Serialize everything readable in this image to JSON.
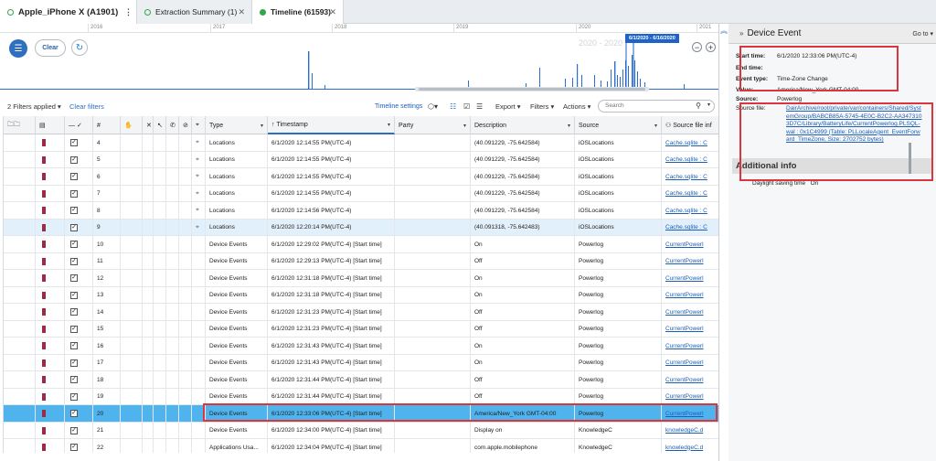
{
  "tabs": {
    "device": "Apple_iPhone X (A1901)",
    "extraction": "Extraction Summary (1)",
    "timeline": "Timeline (61593)"
  },
  "timeline": {
    "years": [
      "2016",
      "2017",
      "2018",
      "2019",
      "2020",
      "2021"
    ],
    "clear_label": "Clear",
    "range_label": "2020 - 2020",
    "range_badge": "6/1/2020 - 6/16/2020"
  },
  "filters": {
    "applied": "2 Filters applied ▾",
    "clear": "Clear filters",
    "timeline_settings": "Timeline settings",
    "export": "Export ▾",
    "filters_btn": "Filters ▾",
    "actions": "Actions ▾",
    "search_placeholder": "Search"
  },
  "columns": {
    "num": "#",
    "type": "Type",
    "timestamp": "Timestamp",
    "party": "Party",
    "description": "Description",
    "source": "Source",
    "source_file": "Source file inf"
  },
  "rows": [
    {
      "num": "4",
      "type": "Locations",
      "ts": "6/1/2020 12:14:55 PM(UTC-4)",
      "desc": "(40.091229, -75.642584)",
      "src": "iOSLocations",
      "file": "Cache.sqlite : C"
    },
    {
      "num": "5",
      "type": "Locations",
      "ts": "6/1/2020 12:14:55 PM(UTC-4)",
      "desc": "(40.091229, -75.642584)",
      "src": "iOSLocations",
      "file": "Cache.sqlite : C"
    },
    {
      "num": "6",
      "type": "Locations",
      "ts": "6/1/2020 12:14:55 PM(UTC-4)",
      "desc": "(40.091229, -75.642584)",
      "src": "iOSLocations",
      "file": "Cache.sqlite : C"
    },
    {
      "num": "7",
      "type": "Locations",
      "ts": "6/1/2020 12:14:55 PM(UTC-4)",
      "desc": "(40.091229, -75.642584)",
      "src": "iOSLocations",
      "file": "Cache.sqlite : C"
    },
    {
      "num": "8",
      "type": "Locations",
      "ts": "6/1/2020 12:14:56 PM(UTC-4)",
      "desc": "(40.091229, -75.642584)",
      "src": "iOSLocations",
      "file": "Cache.sqlite : C"
    },
    {
      "num": "9",
      "type": "Locations",
      "ts": "6/1/2020 12:20:14 PM(UTC-4)",
      "desc": "(40.091318, -75.642483)",
      "src": "iOSLocations",
      "file": "Cache.sqlite : C"
    },
    {
      "num": "10",
      "type": "Device Events",
      "ts": "6/1/2020 12:29:02 PM(UTC-4) [Start time]",
      "desc": "On",
      "src": "Powerlog",
      "file": "CurrentPowerl"
    },
    {
      "num": "11",
      "type": "Device Events",
      "ts": "6/1/2020 12:29:13 PM(UTC-4) [Start time]",
      "desc": "Off",
      "src": "Powerlog",
      "file": "CurrentPowerl"
    },
    {
      "num": "12",
      "type": "Device Events",
      "ts": "6/1/2020 12:31:18 PM(UTC-4) [Start time]",
      "desc": "On",
      "src": "Powerlog",
      "file": "CurrentPowerl"
    },
    {
      "num": "13",
      "type": "Device Events",
      "ts": "6/1/2020 12:31:18 PM(UTC-4) [Start time]",
      "desc": "On",
      "src": "Powerlog",
      "file": "CurrentPowerl"
    },
    {
      "num": "14",
      "type": "Device Events",
      "ts": "6/1/2020 12:31:23 PM(UTC-4) [Start time]",
      "desc": "Off",
      "src": "Powerlog",
      "file": "CurrentPowerl"
    },
    {
      "num": "15",
      "type": "Device Events",
      "ts": "6/1/2020 12:31:23 PM(UTC-4) [Start time]",
      "desc": "Off",
      "src": "Powerlog",
      "file": "CurrentPowerl"
    },
    {
      "num": "16",
      "type": "Device Events",
      "ts": "6/1/2020 12:31:43 PM(UTC-4) [Start time]",
      "desc": "On",
      "src": "Powerlog",
      "file": "CurrentPowerl"
    },
    {
      "num": "17",
      "type": "Device Events",
      "ts": "6/1/2020 12:31:43 PM(UTC-4) [Start time]",
      "desc": "On",
      "src": "Powerlog",
      "file": "CurrentPowerl"
    },
    {
      "num": "18",
      "type": "Device Events",
      "ts": "6/1/2020 12:31:44 PM(UTC-4) [Start time]",
      "desc": "Off",
      "src": "Powerlog",
      "file": "CurrentPowerl"
    },
    {
      "num": "19",
      "type": "Device Events",
      "ts": "6/1/2020 12:31:44 PM(UTC-4) [Start time]",
      "desc": "Off",
      "src": "Powerlog",
      "file": "CurrentPowerl"
    },
    {
      "num": "20",
      "type": "Device Events",
      "ts": "6/1/2020 12:33:06 PM(UTC-4) [Start time]",
      "desc": "America/New_York GMT-04:00",
      "src": "Powerlog",
      "file": "CurrentPowerl"
    },
    {
      "num": "21",
      "type": "Device Events",
      "ts": "6/1/2020 12:34:00 PM(UTC-4) [Start time]",
      "desc": "Display on",
      "src": "KnowledgeC",
      "file": "knowledgeC.d"
    },
    {
      "num": "22",
      "type": "Applications Usa...",
      "ts": "6/1/2020 12:34:04 PM(UTC-4) [Start time]",
      "desc": "com.apple.mobilephone",
      "src": "KnowledgeC",
      "file": "knowledgeC.d"
    }
  ],
  "panel": {
    "title": "Device Event",
    "goto": "Go to ▾",
    "start_label": "Start time:",
    "start_value": "6/1/2020 12:33:06 PM(UTC-4)",
    "end_label": "End time:",
    "event_label": "Event type:",
    "event_value": "Time-Zone Change",
    "value_label": "Value:",
    "value_value": "America/New_York GMT-04:00",
    "source_label": "Source:",
    "source_value": "Powerlog",
    "source_file_label": "Source file:",
    "source_file_value": "DairArchive/root/private/var/containers/Shared/SystemGroup/BABCB85A-5745-4E0C-B2C2-AA3473103D7C/Library/BatteryLife/CurrentPowerlog.PLSQL-wal : 0x1C4999 (Table: PLLocaleAgent_EventForward_TimeZone, Size: 2702752 bytes)",
    "additional_info": "Additional info",
    "dst_label": "Daylight saving time",
    "dst_value": "On"
  },
  "colors": {
    "accent": "#2a6fc4",
    "selected_row": "#4fb3ee",
    "highlight_box": "#d9363e",
    "tag": "#9b2c45"
  }
}
